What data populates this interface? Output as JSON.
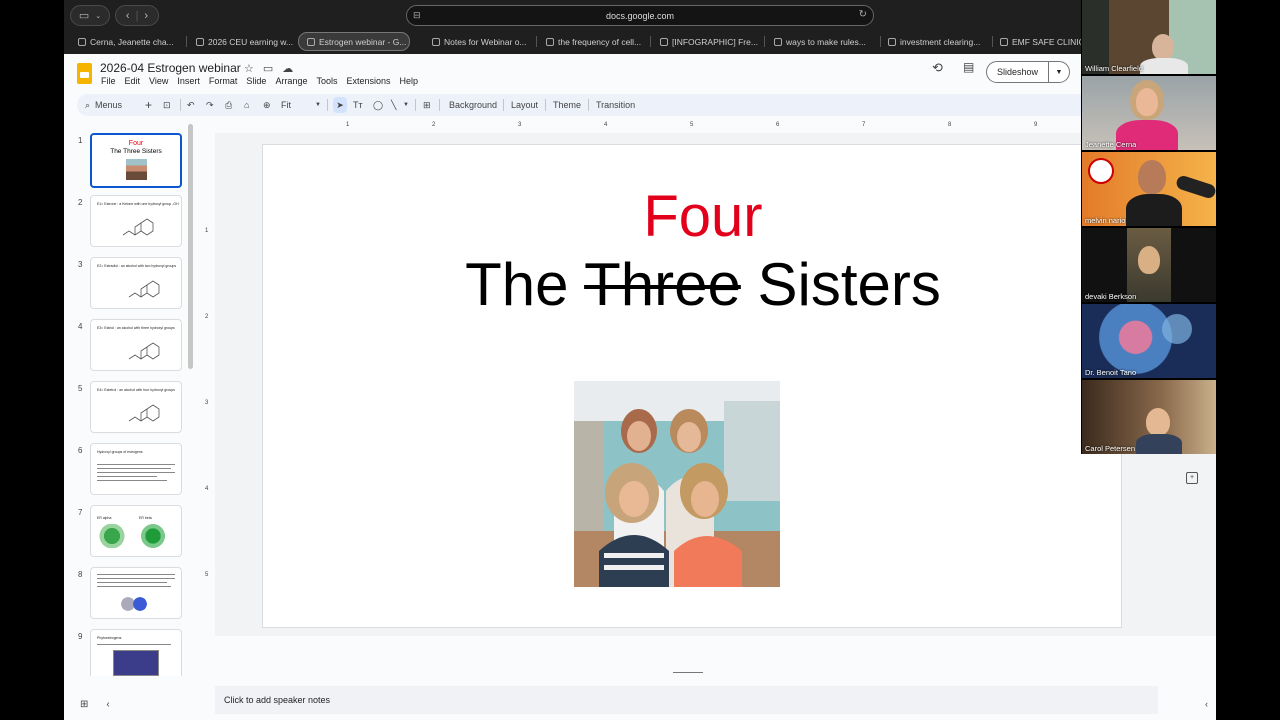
{
  "browser": {
    "url": "docs.google.com",
    "tabs": [
      {
        "label": "Cerna, Jeanette cha..."
      },
      {
        "label": "2026 CEU earning w..."
      },
      {
        "label": "Estrogen webinar - G..."
      },
      {
        "label": "Notes for Webinar o..."
      },
      {
        "label": "the frequency of cell..."
      },
      {
        "label": "[INFOGRAPHIC] Fre..."
      },
      {
        "label": "ways to make rules..."
      },
      {
        "label": "investment clearing..."
      },
      {
        "label": "EMF SAFE CLINIC -"
      }
    ]
  },
  "doc": {
    "title": "2026-04 Estrogen webinar",
    "menus": [
      "File",
      "Edit",
      "View",
      "Insert",
      "Format",
      "Slide",
      "Arrange",
      "Tools",
      "Extensions",
      "Help"
    ],
    "slideshow_label": "Slideshow"
  },
  "toolbar": {
    "search_label": "Menus",
    "zoom_label": "Fit",
    "background_label": "Background",
    "layout_label": "Layout",
    "theme_label": "Theme",
    "transition_label": "Transition"
  },
  "filmstrip": {
    "slides": [
      {
        "num": "1",
        "four": "Four",
        "title": "The Three Sisters"
      },
      {
        "num": "2",
        "heading": "E1= Estrone : a Ketone with one hydroxyl group -OH"
      },
      {
        "num": "3",
        "heading": "E2= Estradiol : an alcohol with two hydroxyl groups"
      },
      {
        "num": "4",
        "heading": "E3= Estriol : an alcohol with three hydroxyl groups"
      },
      {
        "num": "5",
        "heading": "E4= Estetrol : an alcohol with four hydroxyl groups"
      },
      {
        "num": "6",
        "heading": "Hydroxyl groups of estrogens"
      },
      {
        "num": "7",
        "heading": "ER alpha",
        "heading2": "ER beta"
      },
      {
        "num": "8",
        "heading": ""
      },
      {
        "num": "9",
        "heading": "Phytoestrogens"
      }
    ]
  },
  "ruler": {
    "h": [
      "1",
      "2",
      "3",
      "4",
      "5",
      "6",
      "7",
      "8",
      "9"
    ],
    "v": [
      "1",
      "2",
      "3",
      "4",
      "5"
    ]
  },
  "slide": {
    "four": "Four",
    "title_the": "The",
    "title_struck": "Three",
    "title_sisters": "Sisters"
  },
  "notes": {
    "placeholder": "Click to add speaker notes"
  },
  "participants": [
    {
      "name": "William Clearfield"
    },
    {
      "name": "Jeanette Cerna"
    },
    {
      "name": "melvin nario"
    },
    {
      "name": "devaki Berkson"
    },
    {
      "name": "Dr. Benoit Tano"
    },
    {
      "name": "Carol Petersen"
    }
  ],
  "colors": {
    "accent": "#0b57d0",
    "four_red": "#e2001a",
    "logo_yellow": "#f4b400"
  }
}
